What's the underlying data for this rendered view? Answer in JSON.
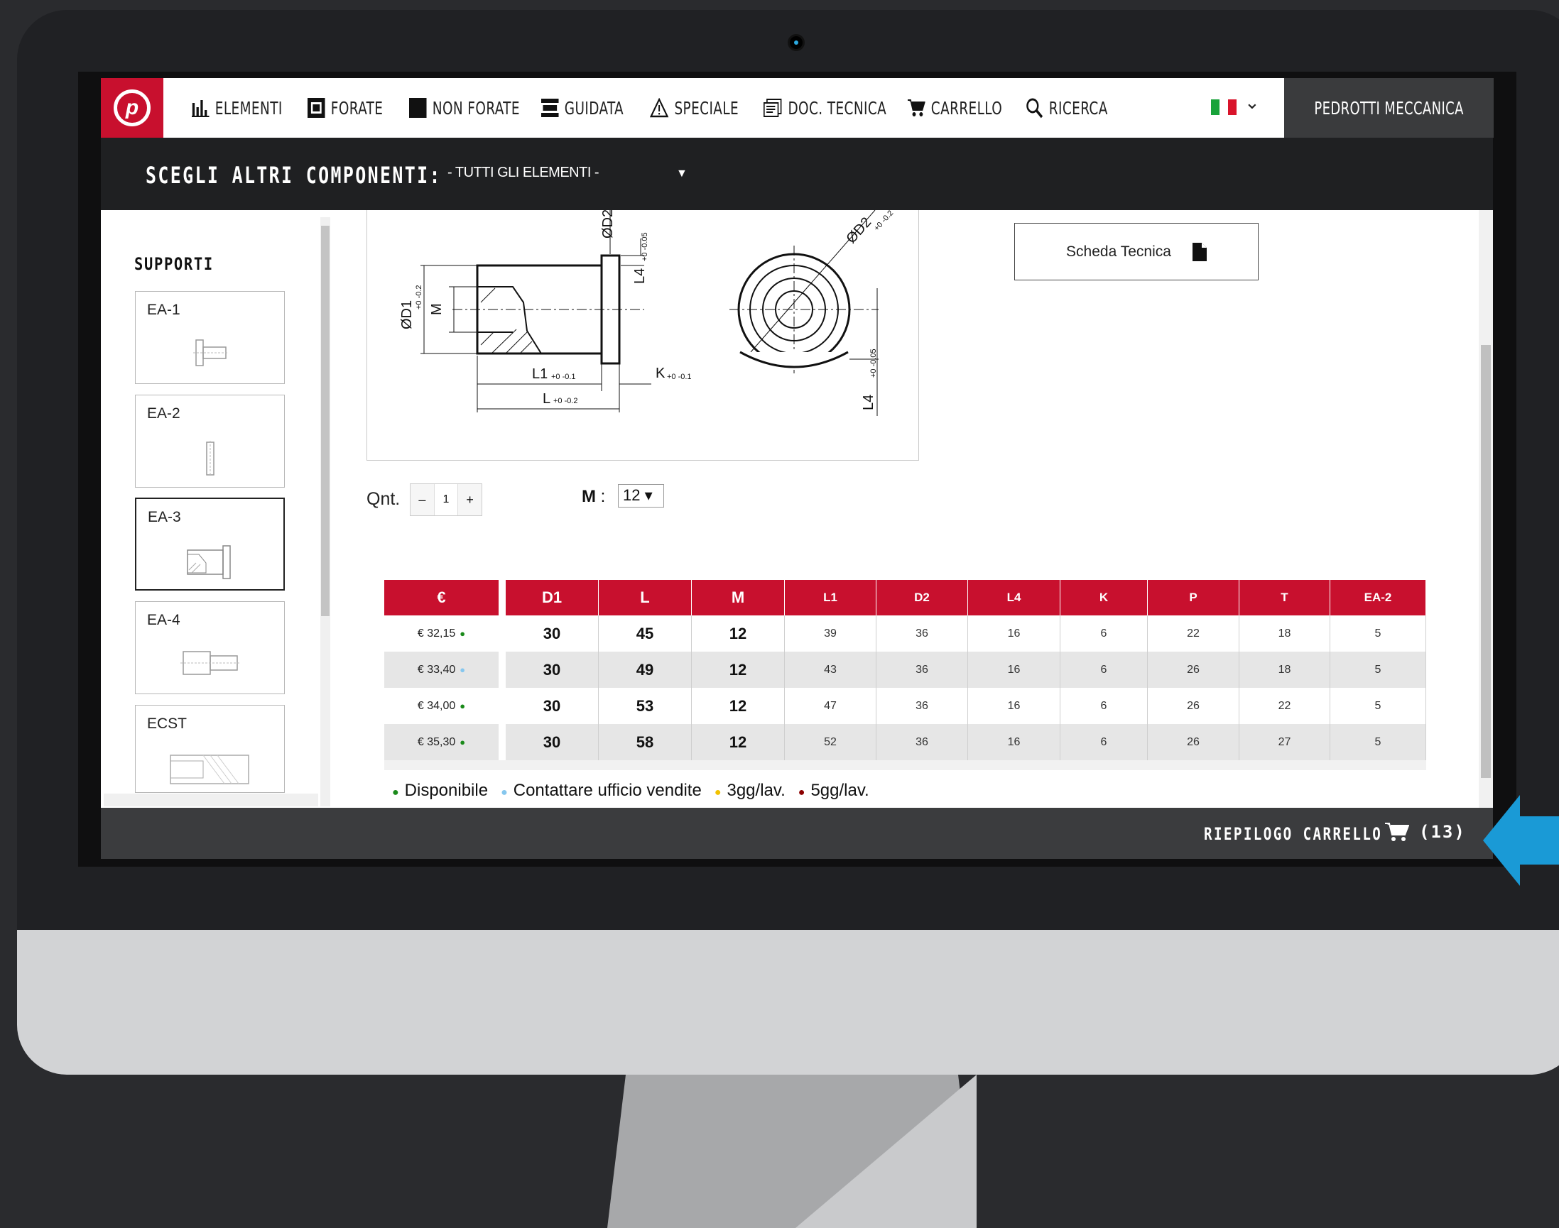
{
  "nav": {
    "items": [
      {
        "label": "ELEMENTI",
        "icon": "bars-icon"
      },
      {
        "label": "FORATE",
        "icon": "frame-icon"
      },
      {
        "label": "NON FORATE",
        "icon": "square-icon"
      },
      {
        "label": "GUIDATA",
        "icon": "stack-icon"
      },
      {
        "label": "SPECIALE",
        "icon": "warning-icon"
      },
      {
        "label": "DOC. TECNICA",
        "icon": "document-icon"
      },
      {
        "label": "CARRELLO",
        "icon": "cart-icon"
      },
      {
        "label": "RICERCA",
        "icon": "search-icon"
      }
    ],
    "brand": "PEDROTTI MECCANICA"
  },
  "choose": {
    "label": "SCEGLI ALTRI COMPONENTI:",
    "selected": "- TUTTI GLI ELEMENTI -"
  },
  "sidebar": {
    "title": "SUPPORTI",
    "items": [
      {
        "label": "EA-1"
      },
      {
        "label": "EA-2"
      },
      {
        "label": "EA-3"
      },
      {
        "label": "EA-4"
      },
      {
        "label": "ECST"
      }
    ]
  },
  "drawing": {
    "labels": {
      "d2_top": "ØD2",
      "d1": "ØD1",
      "d1_tol": "+0 -0.2",
      "m": "M",
      "l4": "L4",
      "l4_tol": "+0 -0.05",
      "l1": "L1",
      "l1_tol": "+0 -0.1",
      "k": "K",
      "k_tol": "+0 -0.1",
      "l": "L",
      "l_tol": "+0 -0.2",
      "d2_side": "ØD2",
      "d2_tol": "+0 -0.2",
      "l4_side": "L4",
      "l4_side_tol": "+0 -0.05"
    }
  },
  "scheda": {
    "label": "Scheda Tecnica"
  },
  "qty": {
    "label": "Qnt.",
    "value": "1",
    "minus": "–",
    "plus": "+"
  },
  "m_select": {
    "label": "M",
    "sep": ":",
    "value": "12 ▾"
  },
  "table": {
    "headers": [
      "€",
      "D1",
      "L",
      "M",
      "L1",
      "D2",
      "L4",
      "K",
      "P",
      "T",
      "EA-2"
    ],
    "rows": [
      {
        "price": "€ 32,15",
        "status": "#1a8a1a",
        "cells": [
          "30",
          "45",
          "12",
          "39",
          "36",
          "16",
          "6",
          "22",
          "18",
          "5"
        ]
      },
      {
        "price": "€ 33,40",
        "status": "#86c7ee",
        "cells": [
          "30",
          "49",
          "12",
          "43",
          "36",
          "16",
          "6",
          "26",
          "18",
          "5"
        ]
      },
      {
        "price": "€ 34,00",
        "status": "#1a8a1a",
        "cells": [
          "30",
          "53",
          "12",
          "47",
          "36",
          "16",
          "6",
          "26",
          "22",
          "5"
        ]
      },
      {
        "price": "€ 35,30",
        "status": "#1a8a1a",
        "cells": [
          "30",
          "58",
          "12",
          "52",
          "36",
          "16",
          "6",
          "26",
          "27",
          "5"
        ]
      }
    ]
  },
  "legend": [
    {
      "label": "Disponibile",
      "color": "#1a8a1a"
    },
    {
      "label": "Contattare ufficio vendite",
      "color": "#86c7ee"
    },
    {
      "label": "3gg/lav.",
      "color": "#f2c200"
    },
    {
      "label": "5gg/lav.",
      "color": "#8b0000"
    }
  ],
  "footer": {
    "summary": "RIEPILOGO CARRELLO",
    "count": "(13)"
  },
  "colors": {
    "accent": "#c8102e",
    "dark": "#1f2022",
    "callout": "#1a9ad6"
  }
}
